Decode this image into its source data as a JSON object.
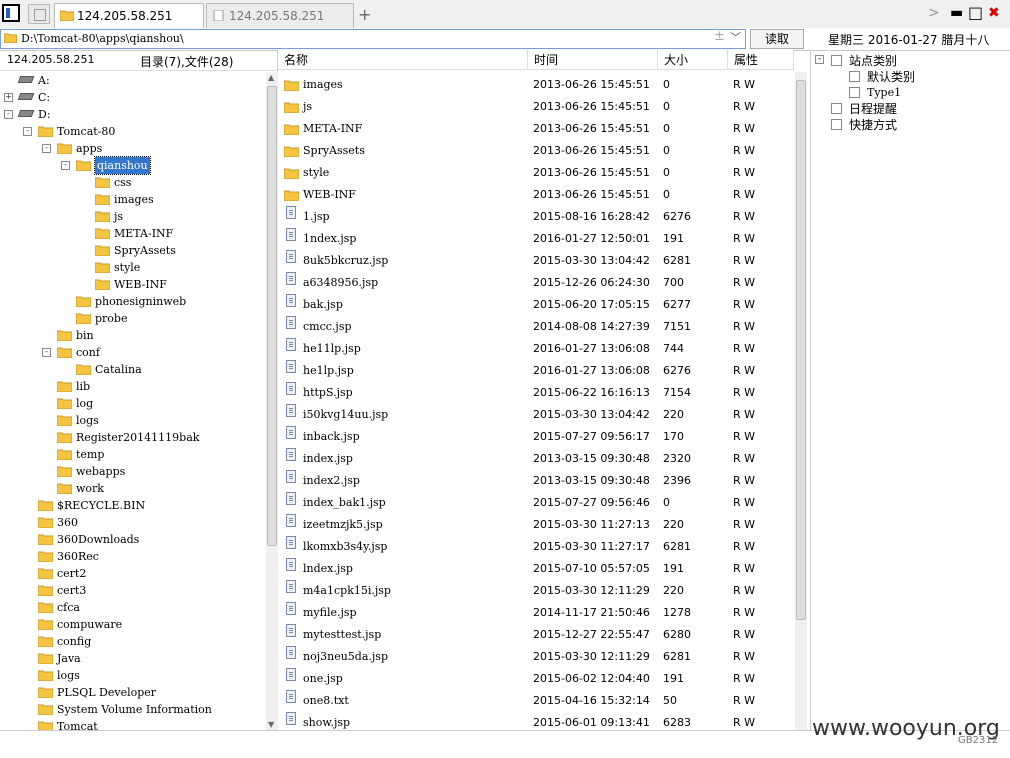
{
  "window": {
    "tabs": [
      {
        "label": "124.205.58.251",
        "active": true
      },
      {
        "label": "124.205.58.251",
        "active": false
      }
    ],
    "controls": {
      "chevron": ">",
      "minimize": "▬",
      "maximize": "□",
      "close": "✖"
    }
  },
  "address": {
    "path": "D:\\Tomcat-80\\apps\\qianshou\\",
    "read_button": "读取",
    "datetime": "星期三  2016-01-27  腊月十八"
  },
  "left": {
    "host": "124.205.58.251",
    "summary": "目录(7),文件(28)",
    "tree": [
      {
        "label": "A:",
        "level": 0,
        "type": "drive",
        "expander": ""
      },
      {
        "label": "C:",
        "level": 0,
        "type": "drive",
        "expander": "+"
      },
      {
        "label": "D:",
        "level": 0,
        "type": "drive",
        "expander": "-"
      },
      {
        "label": "Tomcat-80",
        "level": 1,
        "type": "folder",
        "expander": "-"
      },
      {
        "label": "apps",
        "level": 2,
        "type": "folder",
        "expander": "-"
      },
      {
        "label": "qianshou",
        "level": 3,
        "type": "folder",
        "expander": "-",
        "selected": true
      },
      {
        "label": "css",
        "level": 4,
        "type": "folder",
        "expander": ""
      },
      {
        "label": "images",
        "level": 4,
        "type": "folder",
        "expander": ""
      },
      {
        "label": "js",
        "level": 4,
        "type": "folder",
        "expander": ""
      },
      {
        "label": "META-INF",
        "level": 4,
        "type": "folder",
        "expander": ""
      },
      {
        "label": "SpryAssets",
        "level": 4,
        "type": "folder",
        "expander": ""
      },
      {
        "label": "style",
        "level": 4,
        "type": "folder",
        "expander": ""
      },
      {
        "label": "WEB-INF",
        "level": 4,
        "type": "folder",
        "expander": ""
      },
      {
        "label": "phonesigninweb",
        "level": 3,
        "type": "folder",
        "expander": ""
      },
      {
        "label": "probe",
        "level": 3,
        "type": "folder",
        "expander": ""
      },
      {
        "label": "bin",
        "level": 2,
        "type": "folder",
        "expander": ""
      },
      {
        "label": "conf",
        "level": 2,
        "type": "folder",
        "expander": "-"
      },
      {
        "label": "Catalina",
        "level": 3,
        "type": "folder",
        "expander": ""
      },
      {
        "label": "lib",
        "level": 2,
        "type": "folder",
        "expander": ""
      },
      {
        "label": "log",
        "level": 2,
        "type": "folder",
        "expander": ""
      },
      {
        "label": "logs",
        "level": 2,
        "type": "folder",
        "expander": ""
      },
      {
        "label": "Register20141119bak",
        "level": 2,
        "type": "folder",
        "expander": ""
      },
      {
        "label": "temp",
        "level": 2,
        "type": "folder",
        "expander": ""
      },
      {
        "label": "webapps",
        "level": 2,
        "type": "folder",
        "expander": ""
      },
      {
        "label": "work",
        "level": 2,
        "type": "folder",
        "expander": ""
      },
      {
        "label": "$RECYCLE.BIN",
        "level": 1,
        "type": "folder",
        "expander": ""
      },
      {
        "label": "360",
        "level": 1,
        "type": "folder",
        "expander": ""
      },
      {
        "label": "360Downloads",
        "level": 1,
        "type": "folder",
        "expander": ""
      },
      {
        "label": "360Rec",
        "level": 1,
        "type": "folder",
        "expander": ""
      },
      {
        "label": "cert2",
        "level": 1,
        "type": "folder",
        "expander": ""
      },
      {
        "label": "cert3",
        "level": 1,
        "type": "folder",
        "expander": ""
      },
      {
        "label": "cfca",
        "level": 1,
        "type": "folder",
        "expander": ""
      },
      {
        "label": "compuware",
        "level": 1,
        "type": "folder",
        "expander": ""
      },
      {
        "label": "config",
        "level": 1,
        "type": "folder",
        "expander": ""
      },
      {
        "label": "Java",
        "level": 1,
        "type": "folder",
        "expander": ""
      },
      {
        "label": "logs",
        "level": 1,
        "type": "folder",
        "expander": ""
      },
      {
        "label": "PLSQL Developer",
        "level": 1,
        "type": "folder",
        "expander": ""
      },
      {
        "label": "System Volume Information",
        "level": 1,
        "type": "folder",
        "expander": ""
      },
      {
        "label": "Tomcat",
        "level": 1,
        "type": "folder",
        "expander": ""
      }
    ]
  },
  "files": {
    "columns": [
      "名称",
      "时间",
      "大小",
      "属性"
    ],
    "rows": [
      {
        "name": "images",
        "time": "2013-06-26 15:45:51",
        "size": "0",
        "attr": "R W",
        "type": "folder"
      },
      {
        "name": "js",
        "time": "2013-06-26 15:45:51",
        "size": "0",
        "attr": "R W",
        "type": "folder"
      },
      {
        "name": "META-INF",
        "time": "2013-06-26 15:45:51",
        "size": "0",
        "attr": "R W",
        "type": "folder"
      },
      {
        "name": "SpryAssets",
        "time": "2013-06-26 15:45:51",
        "size": "0",
        "attr": "R W",
        "type": "folder"
      },
      {
        "name": "style",
        "time": "2013-06-26 15:45:51",
        "size": "0",
        "attr": "R W",
        "type": "folder"
      },
      {
        "name": "WEB-INF",
        "time": "2013-06-26 15:45:51",
        "size": "0",
        "attr": "R W",
        "type": "folder"
      },
      {
        "name": "1.jsp",
        "time": "2015-08-16 16:28:42",
        "size": "6276",
        "attr": "R W",
        "type": "file"
      },
      {
        "name": "1ndex.jsp",
        "time": "2016-01-27 12:50:01",
        "size": "191",
        "attr": "R W",
        "type": "file"
      },
      {
        "name": "8uk5bkcruz.jsp",
        "time": "2015-03-30 13:04:42",
        "size": "6281",
        "attr": "R W",
        "type": "file"
      },
      {
        "name": "a6348956.jsp",
        "time": "2015-12-26 06:24:30",
        "size": "700",
        "attr": "R W",
        "type": "file"
      },
      {
        "name": "bak.jsp",
        "time": "2015-06-20 17:05:15",
        "size": "6277",
        "attr": "R W",
        "type": "file"
      },
      {
        "name": "cmcc.jsp",
        "time": "2014-08-08 14:27:39",
        "size": "7151",
        "attr": "R W",
        "type": "file"
      },
      {
        "name": "he11lp.jsp",
        "time": "2016-01-27 13:06:08",
        "size": "744",
        "attr": "R W",
        "type": "file"
      },
      {
        "name": "he1lp.jsp",
        "time": "2016-01-27 13:06:08",
        "size": "6276",
        "attr": "R W",
        "type": "file"
      },
      {
        "name": "httpS.jsp",
        "time": "2015-06-22 16:16:13",
        "size": "7154",
        "attr": "R W",
        "type": "file"
      },
      {
        "name": "i50kvg14uu.jsp",
        "time": "2015-03-30 13:04:42",
        "size": "220",
        "attr": "R W",
        "type": "file"
      },
      {
        "name": "inback.jsp",
        "time": "2015-07-27 09:56:17",
        "size": "170",
        "attr": "R W",
        "type": "file"
      },
      {
        "name": "index.jsp",
        "time": "2013-03-15 09:30:48",
        "size": "2320",
        "attr": "R W",
        "type": "file"
      },
      {
        "name": "index2.jsp",
        "time": "2013-03-15 09:30:48",
        "size": "2396",
        "attr": "R W",
        "type": "file"
      },
      {
        "name": "index_bak1.jsp",
        "time": "2015-07-27 09:56:46",
        "size": "0",
        "attr": "R W",
        "type": "file"
      },
      {
        "name": "izeetmzjk5.jsp",
        "time": "2015-03-30 11:27:13",
        "size": "220",
        "attr": "R W",
        "type": "file"
      },
      {
        "name": "lkomxb3s4y.jsp",
        "time": "2015-03-30 11:27:17",
        "size": "6281",
        "attr": "R W",
        "type": "file"
      },
      {
        "name": "lndex.jsp",
        "time": "2015-07-10 05:57:05",
        "size": "191",
        "attr": "R W",
        "type": "file"
      },
      {
        "name": "m4a1cpk15i.jsp",
        "time": "2015-03-30 12:11:29",
        "size": "220",
        "attr": "R W",
        "type": "file"
      },
      {
        "name": "myfile.jsp",
        "time": "2014-11-17 21:50:46",
        "size": "1278",
        "attr": "R W",
        "type": "file"
      },
      {
        "name": "mytesttest.jsp",
        "time": "2015-12-27 22:55:47",
        "size": "6280",
        "attr": "R W",
        "type": "file"
      },
      {
        "name": "noj3neu5da.jsp",
        "time": "2015-03-30 12:11:29",
        "size": "6281",
        "attr": "R W",
        "type": "file"
      },
      {
        "name": "one.jsp",
        "time": "2015-06-02 12:04:40",
        "size": "191",
        "attr": "R W",
        "type": "file"
      },
      {
        "name": "one8.txt",
        "time": "2015-04-16 15:32:14",
        "size": "50",
        "attr": "R W",
        "type": "file"
      },
      {
        "name": "show.jsp",
        "time": "2015-06-01 09:13:41",
        "size": "6283",
        "attr": "R W",
        "type": "file"
      }
    ]
  },
  "right": {
    "tree": [
      {
        "label": "站点类别",
        "level": 0,
        "expander": "-",
        "icon": "category-icon"
      },
      {
        "label": "默认类别",
        "level": 1,
        "expander": "",
        "icon": "category-item-icon"
      },
      {
        "label": "Type1",
        "level": 1,
        "expander": "",
        "icon": "category-item-icon"
      },
      {
        "label": "日程提醒",
        "level": 0,
        "expander": "",
        "icon": "reminder-icon"
      },
      {
        "label": "快捷方式",
        "level": 0,
        "expander": "",
        "icon": "shortcut-icon"
      }
    ]
  },
  "footer": {
    "watermark": "www.wooyun.org",
    "code": "GB2312"
  },
  "colors": {
    "folder": "#f5c542",
    "folder_edge": "#c9962a",
    "selection": "#3377cc"
  }
}
